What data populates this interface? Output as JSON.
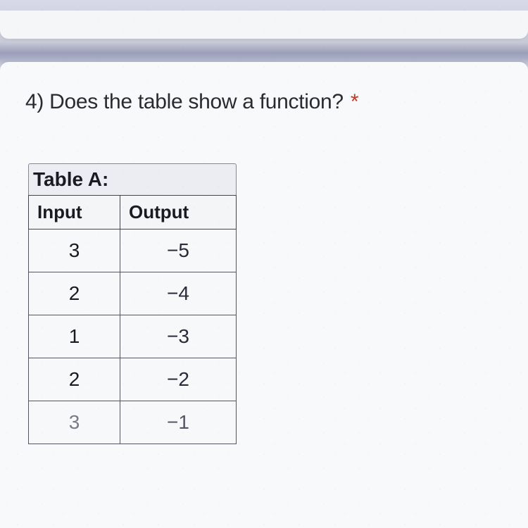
{
  "question": {
    "number": "4)",
    "text": "Does the table show a function?",
    "required_marker": "*"
  },
  "table": {
    "title": "Table A:",
    "headers": {
      "input": "Input",
      "output": "Output"
    },
    "rows": [
      {
        "input": "3",
        "output": "−5"
      },
      {
        "input": "2",
        "output": "−4"
      },
      {
        "input": "1",
        "output": "−3"
      },
      {
        "input": "2",
        "output": "−2"
      },
      {
        "input": "3",
        "output": "−1"
      }
    ]
  },
  "chart_data": {
    "type": "table",
    "title": "Table A:",
    "columns": [
      "Input",
      "Output"
    ],
    "data": [
      [
        3,
        -5
      ],
      [
        2,
        -4
      ],
      [
        1,
        -3
      ],
      [
        2,
        -2
      ],
      [
        3,
        -1
      ]
    ]
  }
}
